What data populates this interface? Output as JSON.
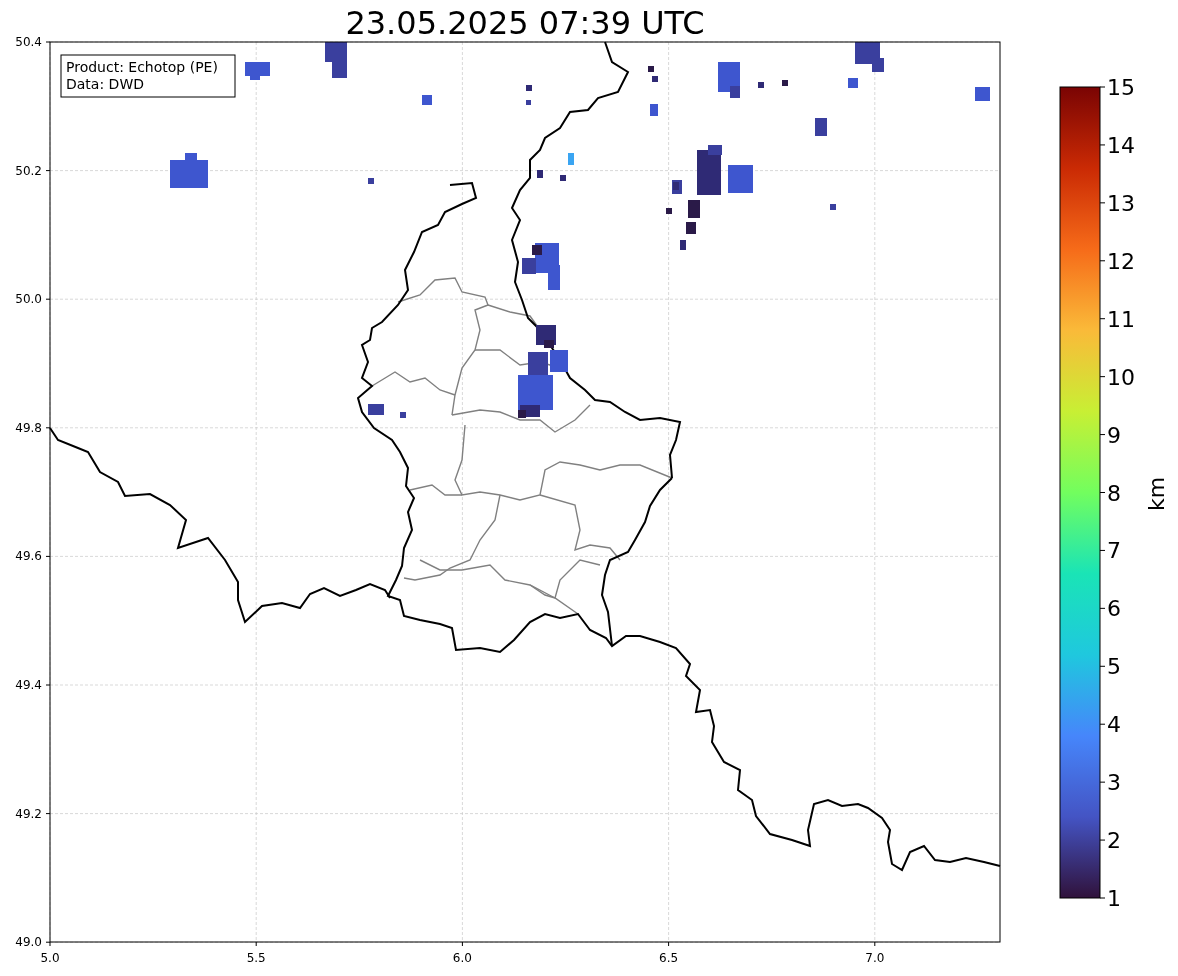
{
  "title": "23.05.2025 07:39 UTC",
  "legend": [
    "Product: Echotop (PE)",
    "Data: DWD"
  ],
  "map": {
    "xticks": [
      "5.0",
      "5.5",
      "6.0",
      "6.5",
      "7.0"
    ],
    "yticks": [
      "50.4",
      "50.2",
      "50.0",
      "49.8",
      "49.6",
      "49.4",
      "49.2",
      "49.0"
    ]
  },
  "colorbar": {
    "label": "km",
    "ticks": [
      "15",
      "14",
      "13",
      "12",
      "11",
      "10",
      "9",
      "8",
      "7",
      "6",
      "5",
      "4",
      "3",
      "2",
      "1"
    ]
  }
}
